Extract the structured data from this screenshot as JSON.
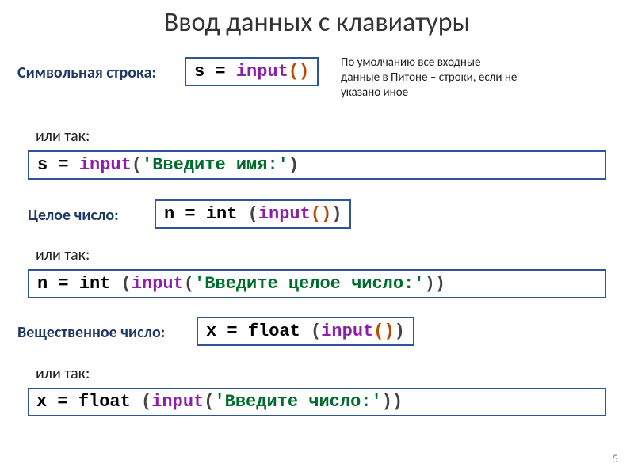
{
  "title": "Ввод данных с клавиатуры",
  "note": "По умолчанию все входные данные в Питоне – строки, если не указано иное",
  "labels": {
    "string": "Символьная строка:",
    "or": "или так:",
    "int": "Целое число:",
    "float": "Вещественное число:"
  },
  "code": {
    "s_input": {
      "lhs": "s = ",
      "fn": "input",
      "open": "(",
      "close": ")"
    },
    "s_input_prompt": {
      "lhs": "s = ",
      "fn": "input",
      "open": "(",
      "arg": "'Введите имя:'",
      "close": ")"
    },
    "n_int": {
      "lhs": "n = ",
      "outer": "int",
      "sp": " ",
      "o1": "(",
      "fn": "input",
      "o2": "(",
      "c2": ")",
      "c1": ")"
    },
    "n_int_prompt": {
      "lhs": "n = ",
      "outer": "int",
      "sp": " ",
      "o1": "(",
      "fn": "input",
      "o2": "(",
      "arg": "'Введите целое число:'",
      "c2": ")",
      "c1": ")"
    },
    "x_float": {
      "lhs": "x = ",
      "outer": "float",
      "sp": " ",
      "o1": "(",
      "fn": "input",
      "o2": "(",
      "c2": ")",
      "c1": ")"
    },
    "x_float_prompt": {
      "lhs": "x = ",
      "outer": "float",
      "sp": " ",
      "o1": "(",
      "fn": "input",
      "o2": "(",
      "arg": "'Введите число:'",
      "c2": ")",
      "c1": ")"
    }
  },
  "page_number": "5"
}
